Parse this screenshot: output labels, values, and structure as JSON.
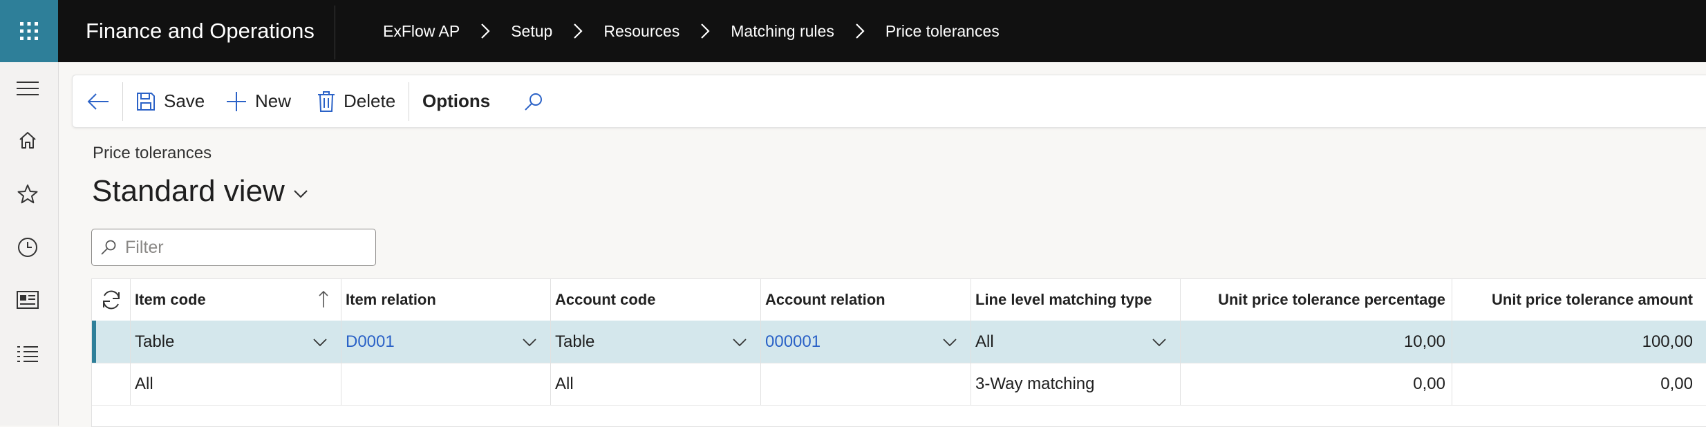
{
  "app": {
    "title": "Finance and Operations"
  },
  "breadcrumb": [
    "ExFlow AP",
    "Setup",
    "Resources",
    "Matching rules",
    "Price tolerances"
  ],
  "nav": {
    "icons": [
      "hamburger-icon",
      "home-icon",
      "star-icon",
      "clock-icon",
      "workspace-icon",
      "list-icon"
    ]
  },
  "toolbar": {
    "save": "Save",
    "new": "New",
    "delete": "Delete",
    "options": "Options"
  },
  "page": {
    "caption": "Price tolerances",
    "view_name": "Standard view"
  },
  "filter": {
    "placeholder": "Filter",
    "value": ""
  },
  "grid": {
    "columns": [
      "Item code",
      "Item relation",
      "Account code",
      "Account relation",
      "Line level matching type",
      "Unit price tolerance percentage",
      "Unit price tolerance amount"
    ],
    "rows": [
      [
        "Table",
        "D0001",
        "Table",
        "000001",
        "All",
        "10,00",
        "100,00"
      ],
      [
        "All",
        "",
        "All",
        "",
        "3-Way matching",
        "0,00",
        "0,00"
      ]
    ],
    "selected_row": 0
  },
  "colors": {
    "topbar": "#111111",
    "waffle": "#2e7f99",
    "selected_row": "#d4e7ec",
    "link": "#2b62c7"
  }
}
